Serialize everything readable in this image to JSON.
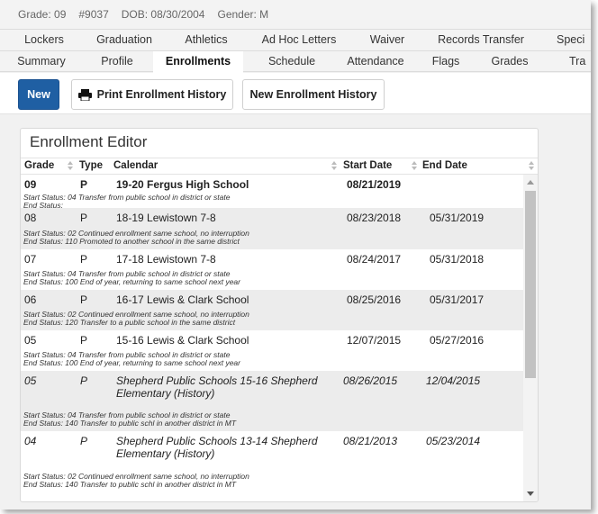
{
  "student": {
    "grade": "Grade: 09",
    "id": "#9037",
    "dob": "DOB: 08/30/2004",
    "gender": "Gender: M"
  },
  "tabs_row1": [
    {
      "label": "Lockers"
    },
    {
      "label": "Graduation"
    },
    {
      "label": "Athletics"
    },
    {
      "label": "Ad Hoc Letters"
    },
    {
      "label": "Waiver"
    },
    {
      "label": "Records Transfer"
    },
    {
      "label": "Speci"
    }
  ],
  "tabs_row2": [
    {
      "label": "Summary"
    },
    {
      "label": "Profile"
    },
    {
      "label": "Enrollments",
      "active": true
    },
    {
      "label": "Schedule"
    },
    {
      "label": "Attendance"
    },
    {
      "label": "Flags"
    },
    {
      "label": "Grades"
    },
    {
      "label": "Tra"
    }
  ],
  "toolbar": {
    "new_label": "New",
    "print_label": "Print Enrollment History",
    "new_history_label": "New Enrollment History"
  },
  "panel": {
    "title": "Enrollment Editor",
    "columns": {
      "grade": "Grade",
      "type": "Type",
      "calendar": "Calendar",
      "start": "Start Date",
      "end": "End Date"
    }
  },
  "rows": [
    {
      "grade": "09",
      "type": "P",
      "calendar": "19-20 Fergus High School",
      "start": "08/21/2019",
      "end": "",
      "start_status": "Start Status: 04 Transfer from public school in district or state",
      "end_status": "End Status:"
    },
    {
      "grade": "08",
      "type": "P",
      "calendar": "18-19 Lewistown 7-8",
      "start": "08/23/2018",
      "end": "05/31/2019",
      "start_status": "Start Status: 02 Continued enrollment same school, no interruption",
      "end_status": "End Status:  110 Promoted to another school in the same district"
    },
    {
      "grade": "07",
      "type": "P",
      "calendar": "17-18 Lewistown 7-8",
      "start": "08/24/2017",
      "end": "05/31/2018",
      "start_status": "Start Status: 04 Transfer from public school in district or state",
      "end_status": "End Status:  100 End of year, returning to same school next year"
    },
    {
      "grade": "06",
      "type": "P",
      "calendar": "16-17 Lewis & Clark School",
      "start": "08/25/2016",
      "end": "05/31/2017",
      "start_status": "Start Status: 02 Continued enrollment same school, no interruption",
      "end_status": "End Status:  120 Transfer to a public school in the same district"
    },
    {
      "grade": "05",
      "type": "P",
      "calendar": "15-16 Lewis & Clark School",
      "start": "12/07/2015",
      "end": "05/27/2016",
      "start_status": "Start Status: 04 Transfer from public school in district or state",
      "end_status": "End Status:  100 End of year, returning to same school next year"
    },
    {
      "grade": "05",
      "type": "P",
      "calendar": "Shepherd Public Schools 15-16 Shepherd Elementary (History)",
      "start": "08/26/2015",
      "end": "12/04/2015",
      "start_status": "Start Status: 04 Transfer from public school in district or state",
      "end_status": "End Status:  140 Transfer to public schl in another district in MT"
    },
    {
      "grade": "04",
      "type": "P",
      "calendar": "Shepherd Public Schools 13-14 Shepherd Elementary (History)",
      "start": "08/21/2013",
      "end": "05/23/2014",
      "start_status": "Start Status: 02 Continued enrollment same school, no interruption",
      "end_status": "End Status:  140 Transfer to public schl in another district in MT"
    }
  ],
  "colors": {
    "primary": "#1f5fa3",
    "row_alt": "#ececec",
    "background": "#f1f1f1"
  }
}
